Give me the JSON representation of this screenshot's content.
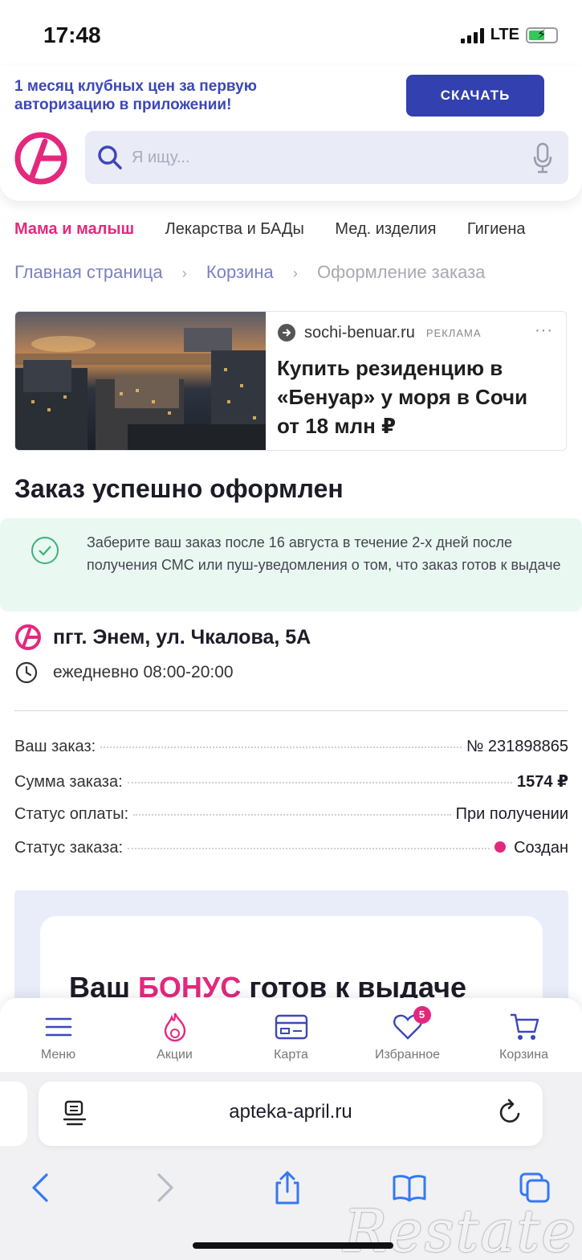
{
  "status_bar": {
    "time": "17:48",
    "network": "LTE"
  },
  "promo": {
    "text": "1 месяц клубных цен за первую авторизацию в приложении!",
    "button_label": "СКАЧАТЬ"
  },
  "search": {
    "placeholder": "Я ищу..."
  },
  "categories": [
    {
      "label": "Мама и малыш",
      "active": true
    },
    {
      "label": "Лекарства и БАДы",
      "active": false
    },
    {
      "label": "Мед. изделия",
      "active": false
    },
    {
      "label": "Гигиена",
      "active": false
    }
  ],
  "breadcrumb": [
    "Главная страница",
    "Корзина",
    "Оформление заказа"
  ],
  "ad": {
    "domain": "sochi-benuar.ru",
    "label": "РЕКЛАМА",
    "more": "···",
    "title": "Купить резиденцию в «Бенуар» у моря в Сочи от 18 млн ₽"
  },
  "order": {
    "title": "Заказ успешно оформлен",
    "info": "Заберите ваш заказ после 16 августа в течение 2-х дней после получения СМС или пуш-уведомления о том, что заказ готов к выдаче",
    "address": "пгт. Энем, ул. Чкалова, 5А",
    "hours": "ежедневно 08:00-20:00",
    "details": [
      {
        "label": "Ваш заказ:",
        "value": "№ 231898865"
      },
      {
        "label": "Сумма заказа:",
        "value": "1574 ₽"
      },
      {
        "label": "Статус оплаты:",
        "value": "При получении"
      },
      {
        "label": "Статус заказа:",
        "value": "Создан"
      }
    ]
  },
  "bonus": {
    "prefix": "Ваш",
    "accent": "БОНУС",
    "suffix": "готов к выдаче"
  },
  "tabs": [
    {
      "label": "Меню",
      "icon": "menu-icon"
    },
    {
      "label": "Акции",
      "icon": "flame-icon"
    },
    {
      "label": "Карта",
      "icon": "card-icon"
    },
    {
      "label": "Избранное",
      "icon": "heart-icon",
      "badge": "5"
    },
    {
      "label": "Корзина",
      "icon": "cart-icon"
    }
  ],
  "browser": {
    "url": "apteka-april.ru"
  },
  "watermark": "Restate",
  "colors": {
    "brand_pink": "#e3287e",
    "brand_blue": "#3240b0",
    "success_bg": "#eaf8f2"
  }
}
